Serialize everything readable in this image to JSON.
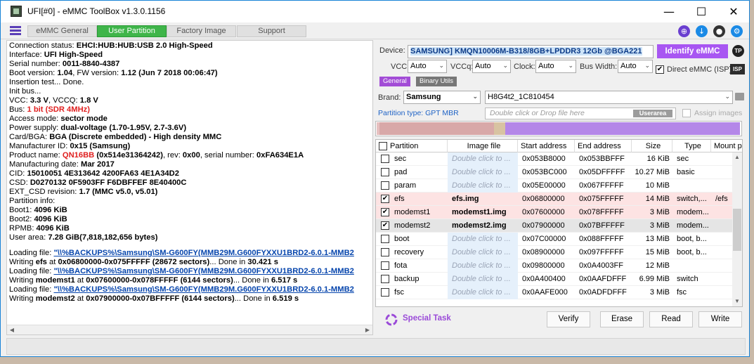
{
  "window": {
    "title": "UFI[#0] - eMMC ToolBox v1.3.0.1156",
    "minimize": "—",
    "maximize": "☐",
    "close": "✕"
  },
  "tabs": [
    {
      "label": "eMMC General"
    },
    {
      "label": "User Partition",
      "active": true
    },
    {
      "label": "Factory Image"
    },
    {
      "label": "Support"
    }
  ],
  "top_icons": [
    "globe-icon",
    "download-icon",
    "lightbulb-icon",
    "gear-icon"
  ],
  "log": {
    "lines": [
      [
        [
          "Connection status: ",
          ""
        ],
        [
          "EHCI:HUB:HUB:USB 2.0 High-Speed",
          "b"
        ]
      ],
      [
        [
          "Interface: ",
          ""
        ],
        [
          "UFI High-Speed",
          "b"
        ]
      ],
      [
        [
          "Serial number: ",
          ""
        ],
        [
          "0011-8840-4387",
          "b"
        ]
      ],
      [
        [
          " Boot version: ",
          ""
        ],
        [
          "1.04",
          "b"
        ],
        [
          ", FW version: ",
          ""
        ],
        [
          "1.12 (Jun  7 2018 00:06:47)",
          "b"
        ]
      ],
      [
        [
          "Insertion test... Done.",
          ""
        ]
      ],
      [
        [
          "Init bus...",
          ""
        ]
      ],
      [
        [
          "VCC: ",
          ""
        ],
        [
          "3.3 V",
          "b"
        ],
        [
          ", VCCQ: ",
          ""
        ],
        [
          "1.8 V",
          "b"
        ]
      ],
      [
        [
          "Bus: ",
          ""
        ],
        [
          "1 bit (SDR 4MHz)",
          "red"
        ]
      ],
      [
        [
          "Access mode: ",
          ""
        ],
        [
          "sector mode",
          "b"
        ]
      ],
      [
        [
          "Power supply: ",
          ""
        ],
        [
          "dual-voltage (1.70-1.95V, 2.7-3.6V)",
          "b"
        ]
      ],
      [
        [
          " Card/BGA: ",
          ""
        ],
        [
          "BGA (Discrete embedded) - High density MMC",
          "b"
        ]
      ],
      [
        [
          "Manufacturer ID: ",
          ""
        ],
        [
          "0x15 (Samsung)",
          "b"
        ]
      ],
      [
        [
          "Product name: ",
          ""
        ],
        [
          "QN16BB",
          "red"
        ],
        [
          " (0x514e31364242)",
          "b"
        ],
        [
          ", rev: ",
          ""
        ],
        [
          "0x00",
          "b"
        ],
        [
          ", serial number: ",
          ""
        ],
        [
          "0xFA634E1A",
          "b"
        ]
      ],
      [
        [
          "Manufacturing date: ",
          ""
        ],
        [
          "Mar 2017",
          "b"
        ]
      ],
      [
        [
          "CID: ",
          ""
        ],
        [
          "15010051 4E313642 4200FA63 4E1A34D2",
          "b"
        ]
      ],
      [
        [
          "CSD: ",
          ""
        ],
        [
          "D0270132 0F5903FF F6DBFFEF 8E40400C",
          "b"
        ]
      ],
      [
        [
          "EXT_CSD revision: ",
          ""
        ],
        [
          "1.7 (MMC v5.0, v5.01)",
          "b"
        ]
      ],
      [
        [
          "Partition info:",
          ""
        ]
      ],
      [
        [
          " Boot1: ",
          ""
        ],
        [
          "4096 KiB",
          "b"
        ]
      ],
      [
        [
          " Boot2: ",
          ""
        ],
        [
          "4096 KiB",
          "b"
        ]
      ],
      [
        [
          " RPMB: ",
          ""
        ],
        [
          "4096 KiB",
          "b"
        ]
      ],
      [
        [
          " User area: ",
          ""
        ],
        [
          "7.28 GiB(7,818,182,656 bytes)",
          "b"
        ]
      ],
      [
        [
          "",
          ""
        ]
      ],
      [
        [
          "Loading file: ",
          ""
        ],
        [
          "\"\\\\%BACKUPS%\\Samsung\\SM-G600FY(MMB29M.G600FYXXU1BRD2-6.0.1-MMB2",
          "link"
        ]
      ],
      [
        [
          "Writing ",
          ""
        ],
        [
          "efs",
          "b"
        ],
        [
          " at ",
          ""
        ],
        [
          "0x06800000-0x075FFFFF",
          "b"
        ],
        [
          " (28672 sectors)",
          "b"
        ],
        [
          "... Done in ",
          ""
        ],
        [
          "30.421 s",
          "b"
        ]
      ],
      [
        [
          "Loading file: ",
          ""
        ],
        [
          "\"\\\\%BACKUPS%\\Samsung\\SM-G600FY(MMB29M.G600FYXXU1BRD2-6.0.1-MMB2",
          "link"
        ]
      ],
      [
        [
          "Writing ",
          ""
        ],
        [
          "modemst1",
          "b"
        ],
        [
          " at ",
          ""
        ],
        [
          "0x07600000-0x078FFFFF",
          "b"
        ],
        [
          " (6144 sectors)",
          "b"
        ],
        [
          "... Done in ",
          ""
        ],
        [
          "6.517 s",
          "b"
        ]
      ],
      [
        [
          "Loading file: ",
          ""
        ],
        [
          "\"\\\\%BACKUPS%\\Samsung\\SM-G600FY(MMB29M.G600FYXXU1BRD2-6.0.1-MMB2",
          "link"
        ]
      ],
      [
        [
          "Writing ",
          ""
        ],
        [
          "modemst2",
          "b"
        ],
        [
          " at ",
          ""
        ],
        [
          "0x07900000-0x07BFFFFF",
          "b"
        ],
        [
          " (6144 sectors)",
          "b"
        ],
        [
          "... Done in ",
          ""
        ],
        [
          "6.519 s",
          "b"
        ]
      ]
    ]
  },
  "device": {
    "label": "Device:",
    "value": "SAMSUNG] KMQN10006M-B318/8GB+LPDDR3 12Gb  @BGA221",
    "identify_button": "Identify eMMC",
    "tp_label": "TP"
  },
  "voltages": {
    "vcc_label": "VCC:",
    "vcc_value": "Auto",
    "vccq_label": "VCCq:",
    "vccq_value": "Auto",
    "clock_label": "Clock:",
    "clock_value": "Auto",
    "buswidth_label": "Bus Width:",
    "buswidth_value": "Auto",
    "direct_label": "Direct eMMC (ISP)",
    "direct_checked": true,
    "isp_icon_label": "ISP"
  },
  "subtabs": {
    "general": "General",
    "binary": "Binary Utils"
  },
  "brand": {
    "label": "Brand:",
    "value": "Samsung",
    "model": "H8G4t2_1C810454"
  },
  "partition_type": "Partition type: GPT MBR",
  "image_drop": {
    "placeholder": "Double click or Drop file here",
    "userarea": "Userarea",
    "assign_label": "Assign images"
  },
  "table": {
    "headers": [
      "Partition",
      "Image file",
      "Start address",
      "End address",
      "Size",
      "Type",
      "Mount p"
    ],
    "rows": [
      {
        "checked": false,
        "name": "sec",
        "image": "Double click to ...",
        "start": "0x053B8000",
        "end": "0x053BBFFF",
        "size": "16 KiB",
        "type": "sec",
        "mount": "",
        "style": ""
      },
      {
        "checked": false,
        "name": "pad",
        "image": "Double click to ...",
        "start": "0x053BC000",
        "end": "0x05DFFFFF",
        "size": "10.27 MiB",
        "type": "basic",
        "mount": "",
        "style": ""
      },
      {
        "checked": false,
        "name": "param",
        "image": "Double click to ...",
        "start": "0x05E00000",
        "end": "0x067FFFFF",
        "size": "10 MiB",
        "type": "",
        "mount": "",
        "style": ""
      },
      {
        "checked": true,
        "name": "efs",
        "image": "efs.img",
        "start": "0x06800000",
        "end": "0x075FFFFF",
        "size": "14 MiB",
        "type": "switch,...",
        "mount": "/efs",
        "style": "red"
      },
      {
        "checked": true,
        "name": "modemst1",
        "image": "modemst1.img",
        "start": "0x07600000",
        "end": "0x078FFFFF",
        "size": "3 MiB",
        "type": "modem...",
        "mount": "",
        "style": "red"
      },
      {
        "checked": true,
        "name": "modemst2",
        "image": "modemst2.img",
        "start": "0x07900000",
        "end": "0x07BFFFFF",
        "size": "3 MiB",
        "type": "modem...",
        "mount": "",
        "style": "gray"
      },
      {
        "checked": false,
        "name": "boot",
        "image": "Double click to ...",
        "start": "0x07C00000",
        "end": "0x088FFFFF",
        "size": "13 MiB",
        "type": "boot, b...",
        "mount": "",
        "style": ""
      },
      {
        "checked": false,
        "name": "recovery",
        "image": "Double click to ...",
        "start": "0x08900000",
        "end": "0x097FFFFF",
        "size": "15 MiB",
        "type": "boot, b...",
        "mount": "",
        "style": ""
      },
      {
        "checked": false,
        "name": "fota",
        "image": "Double click to ...",
        "start": "0x09800000",
        "end": "0x0A4003FF",
        "size": "12 MiB",
        "type": "",
        "mount": "",
        "style": ""
      },
      {
        "checked": false,
        "name": "backup",
        "image": "Double click to ...",
        "start": "0x0A400400",
        "end": "0x0AAFDFFF",
        "size": "6.99 MiB",
        "type": "switch",
        "mount": "",
        "style": ""
      },
      {
        "checked": false,
        "name": "fsc",
        "image": "Double click to ...",
        "start": "0x0AAFE000",
        "end": "0x0ADFDFFF",
        "size": "3 MiB",
        "type": "fsc",
        "mount": "",
        "style": ""
      }
    ]
  },
  "actions": {
    "special_task": "Special Task",
    "verify": "Verify",
    "erase": "Erase",
    "read": "Read",
    "write": "Write"
  },
  "colors": {
    "accent_green": "#3fb54a",
    "accent_purple": "#a856f2",
    "highlight_row": "#fde3e3"
  }
}
